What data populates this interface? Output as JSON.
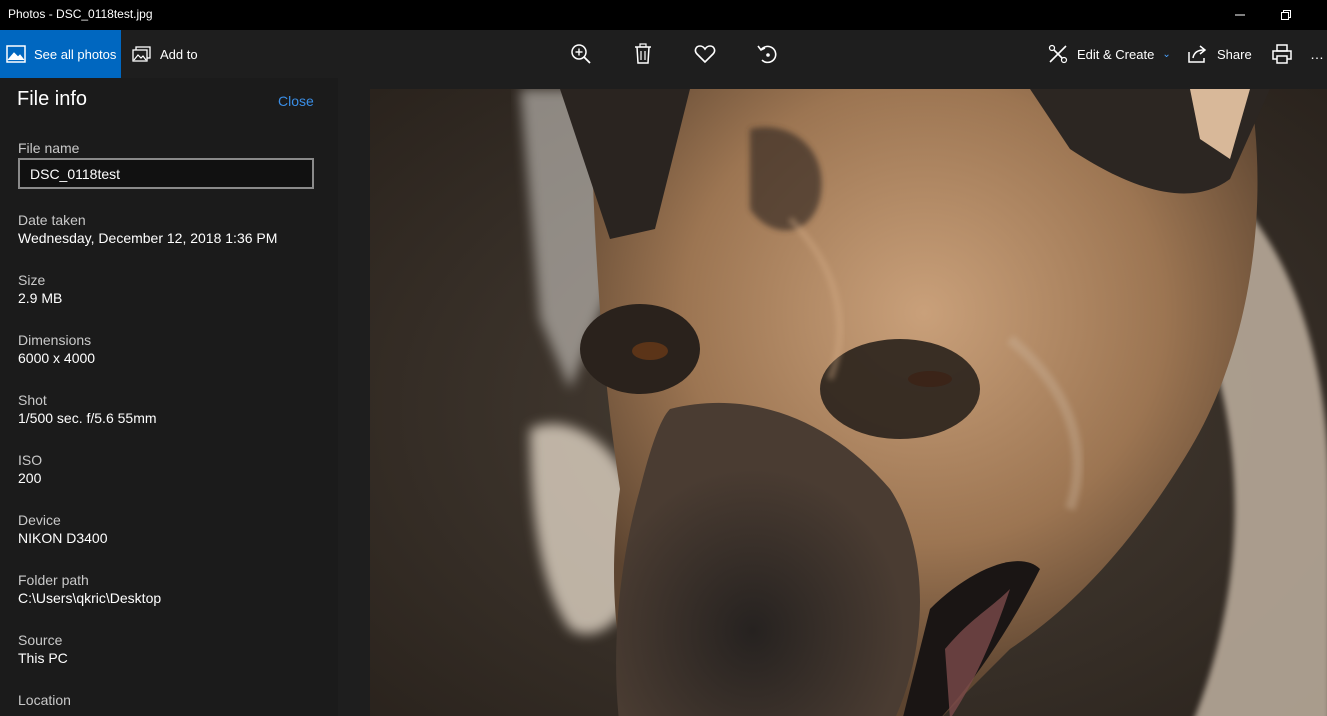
{
  "window": {
    "title": "Photos - DSC_0118test.jpg"
  },
  "toolbar": {
    "see_all_photos": "See all photos",
    "add_to": "Add to",
    "edit_create": "Edit & Create",
    "share": "Share",
    "more": "…"
  },
  "panel": {
    "title": "File info",
    "close": "Close",
    "file_name_label": "File name",
    "file_name_value": "DSC_0118test",
    "fields": [
      {
        "label": "Date taken",
        "value": "Wednesday, December 12, 2018 1:36 PM"
      },
      {
        "label": "Size",
        "value": "2.9 MB"
      },
      {
        "label": "Dimensions",
        "value": "6000 x 4000"
      },
      {
        "label": "Shot",
        "value": "1/500 sec. f/5.6 55mm"
      },
      {
        "label": "ISO",
        "value": "200"
      },
      {
        "label": "Device",
        "value": "NIKON D3400"
      },
      {
        "label": "Folder path",
        "value": "C:\\Users\\qkric\\Desktop"
      },
      {
        "label": "Source",
        "value": "This PC"
      },
      {
        "label": "Location",
        "value": ""
      }
    ]
  },
  "icons": {
    "see_all": "photos-icon",
    "add_to": "add-to-album-icon",
    "zoom": "zoom-in-icon",
    "delete": "trash-icon",
    "favorite": "heart-icon",
    "rotate": "rotate-icon",
    "edit": "edit-create-icon",
    "share": "share-icon",
    "print": "printer-icon"
  },
  "colors": {
    "accent": "#0067c0",
    "link": "#3a8ee6",
    "panel_bg": "#1b1b1b"
  }
}
